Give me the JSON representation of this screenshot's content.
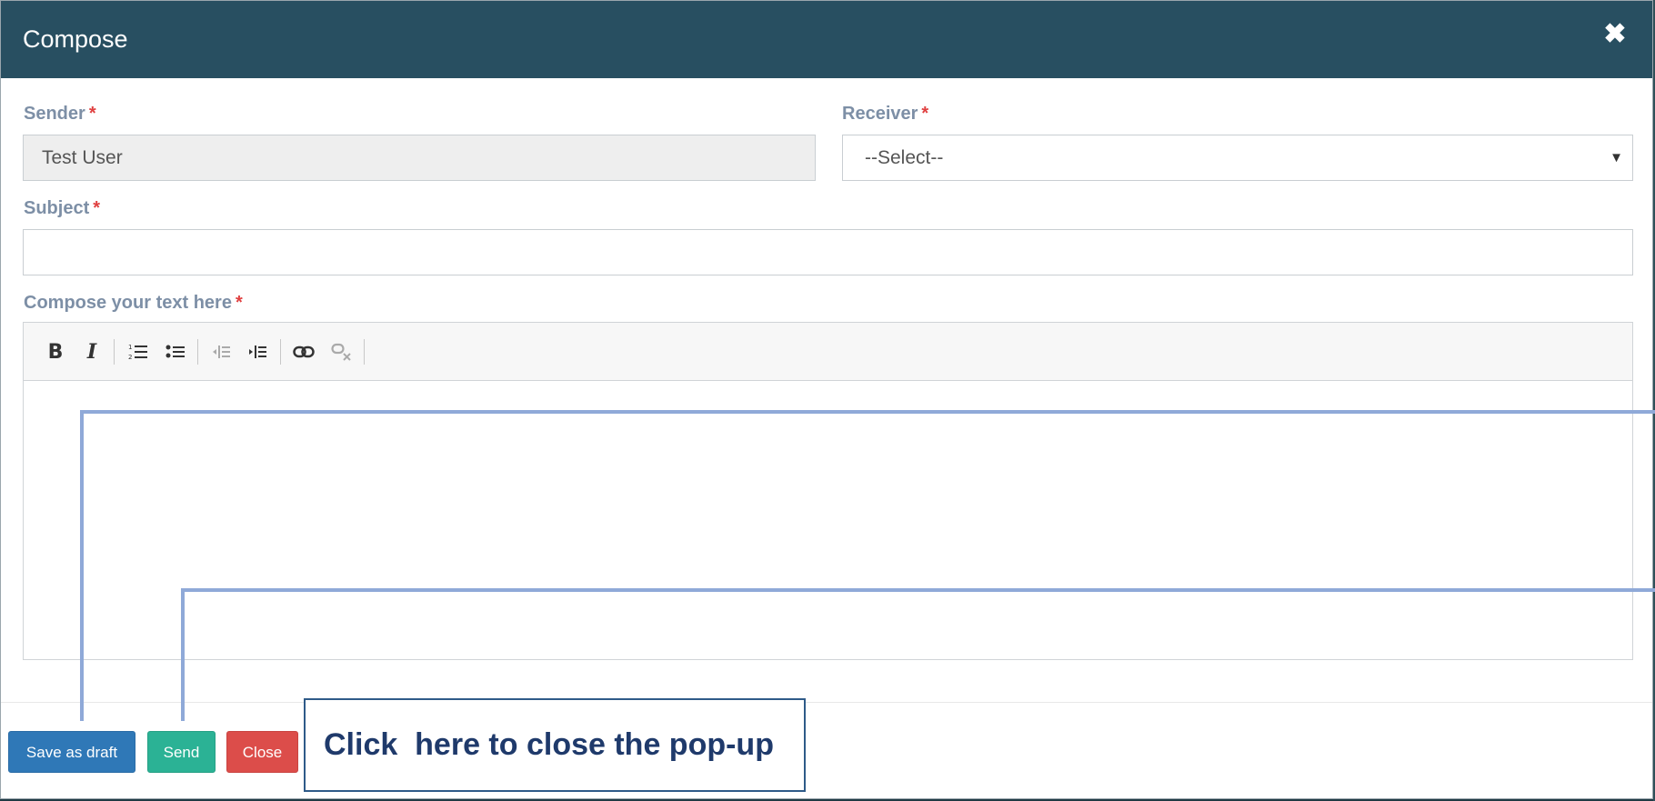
{
  "modal": {
    "title": "Compose",
    "close_icon": "✖"
  },
  "form": {
    "sender": {
      "label": "Sender",
      "required_mark": "*",
      "value": "Test User"
    },
    "receiver": {
      "label": "Receiver",
      "required_mark": "*",
      "value": "--Select--",
      "caret": "▼"
    },
    "subject": {
      "label": "Subject",
      "required_mark": "*",
      "value": ""
    },
    "body": {
      "label": "Compose your text here",
      "required_mark": "*"
    }
  },
  "toolbar": {
    "icons": [
      "bold-icon",
      "italic-icon",
      "ordered-list-icon",
      "unordered-list-icon",
      "outdent-icon",
      "indent-icon",
      "link-icon",
      "unlink-icon"
    ],
    "bold_glyph": "B",
    "italic_glyph": "I"
  },
  "footer": {
    "save_draft_label": "Save as draft",
    "send_label": "Send",
    "close_label": "Close"
  },
  "annotation": {
    "callout_text": "Click  here to close the pop-up",
    "line_color": "#8fa9d8"
  },
  "colors": {
    "header_bg": "#284f61",
    "draft_btn": "#2f78b7",
    "send_btn": "#2bb295",
    "close_btn": "#dc4d4a",
    "required": "#e04040"
  }
}
